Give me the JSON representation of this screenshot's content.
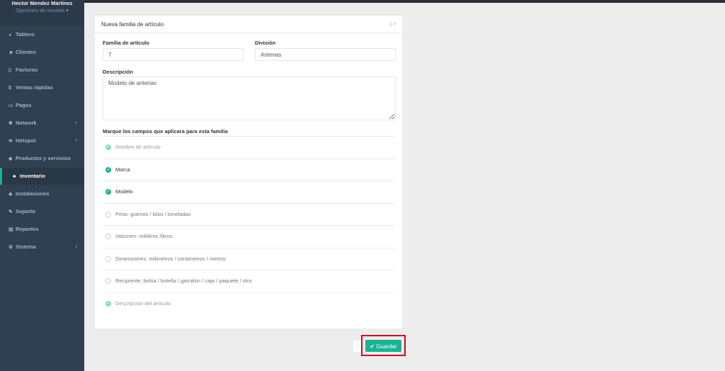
{
  "user": {
    "name": "Hector Mendez Martinez",
    "options_label": "Opciones de usuario",
    "options_caret": "▾"
  },
  "sidebar": {
    "items": [
      {
        "label": "Tablero",
        "icon": "dashboard-icon",
        "glyph": "◕"
      },
      {
        "label": "Clientes",
        "icon": "users-icon",
        "glyph": "☻"
      },
      {
        "label": "Facturas",
        "icon": "file-icon",
        "glyph": "▯"
      },
      {
        "label": "Ventas rápidas",
        "icon": "dollar-icon",
        "glyph": "$"
      },
      {
        "label": "Pagos",
        "icon": "money-icon",
        "glyph": "▭"
      },
      {
        "label": "Network",
        "icon": "network-icon",
        "glyph": "✱",
        "chevron": "‹"
      },
      {
        "label": "Hotspot",
        "icon": "wifi-icon",
        "glyph": "≋",
        "chevron": "‹"
      },
      {
        "label": "Productos y servicios",
        "icon": "tag-icon",
        "glyph": "◆"
      },
      {
        "label": "Inventario",
        "icon": "cubes-icon",
        "glyph": "♣",
        "active": true
      },
      {
        "label": "Instalaciones",
        "icon": "tools-icon",
        "glyph": "◈"
      },
      {
        "label": "Soporte",
        "icon": "wrench-icon",
        "glyph": "✎"
      },
      {
        "label": "Reportes",
        "icon": "book-icon",
        "glyph": "▤"
      },
      {
        "label": "Sistema",
        "icon": "cogs-icon",
        "glyph": "⚙",
        "chevron": "‹"
      }
    ]
  },
  "form": {
    "title": "Nueva familia de artículo",
    "tools": "▯ ×",
    "family_label": "Familia de artículo",
    "family_value": "7",
    "division_label": "División",
    "division_value": "Antenas",
    "description_label": "Descripción",
    "description_value": "Modelo de antenas",
    "fields_label": "Marque los campos que aplicara para esta familia",
    "fields": [
      {
        "label": "Nombre de artículo",
        "state": "dim"
      },
      {
        "label": "Marca",
        "state": "on"
      },
      {
        "label": "Modelo",
        "state": "on"
      },
      {
        "label": "Peso: gramos / kilos / toneladas",
        "state": "off"
      },
      {
        "label": "Volumen: mililitros /litros",
        "state": "off"
      },
      {
        "label": "Dimensiones: milimetros / centimetros / metros",
        "state": "off"
      },
      {
        "label": "Recipiente: bolsa / botella / garrafon / caja / paquete / otro",
        "state": "off"
      },
      {
        "label": "Descripción del artículo",
        "state": "dim"
      }
    ]
  },
  "actions": {
    "cancel_glyph": "‹",
    "save_label": "Guardar",
    "check_glyph": "✔"
  },
  "colors": {
    "accent": "#1ab394",
    "sidebar": "#2f4050",
    "highlight": "#d0021b"
  }
}
